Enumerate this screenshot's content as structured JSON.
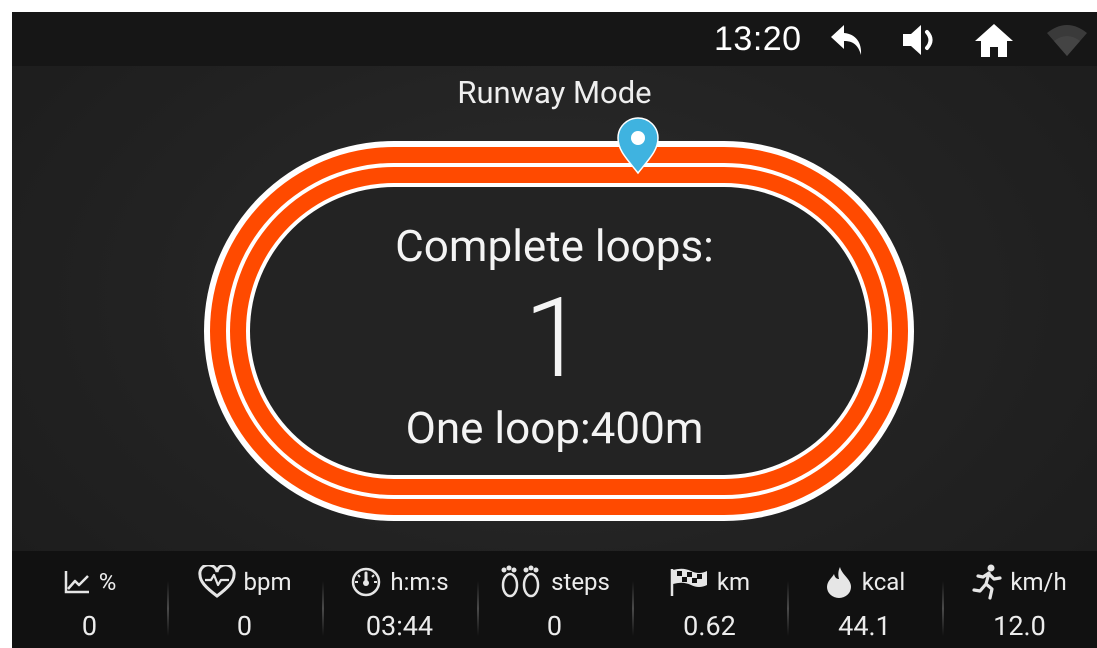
{
  "status_bar": {
    "time": "13:20",
    "icons": [
      "back-arrow-icon",
      "volume-icon",
      "home-icon",
      "wifi-icon"
    ]
  },
  "mode": {
    "title": "Runway Mode"
  },
  "track": {
    "complete_loops_label": "Complete loops:",
    "complete_loops_value": "1",
    "one_loop_label": "One loop:400m",
    "marker_icon": "location-pin-icon",
    "colors": {
      "lane": "#ff4a00",
      "line": "#ffffff",
      "pin": "#3fb3e0"
    }
  },
  "stats": [
    {
      "icon": "incline-chart-icon",
      "unit": "%",
      "value": "0"
    },
    {
      "icon": "heart-rate-icon",
      "unit": "bpm",
      "value": "0"
    },
    {
      "icon": "stopwatch-icon",
      "unit": "h:m:s",
      "value": "03:44"
    },
    {
      "icon": "footprints-icon",
      "unit": "steps",
      "value": "0"
    },
    {
      "icon": "checkered-flag-icon",
      "unit": "km",
      "value": "0.62"
    },
    {
      "icon": "flame-icon",
      "unit": "kcal",
      "value": "44.1"
    },
    {
      "icon": "runner-icon",
      "unit": "km/h",
      "value": "12.0"
    }
  ]
}
